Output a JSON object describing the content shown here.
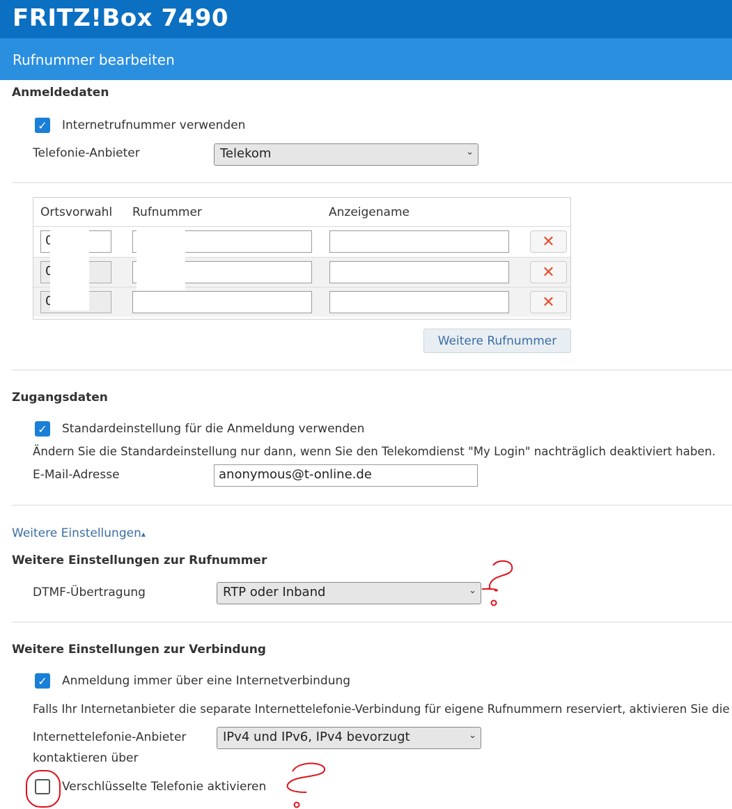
{
  "app": {
    "title": "FRITZ!Box 7490",
    "subtitle": "Rufnummer bearbeiten"
  },
  "anmeldedaten": {
    "heading": "Anmeldedaten",
    "use_internet_number_label": "Internetrufnummer verwenden",
    "use_internet_number_checked": true,
    "provider_label": "Telefonie-Anbieter",
    "provider_value": "Telekom"
  },
  "numbers_table": {
    "headers": [
      "Ortsvorwahl",
      "Rufnummer",
      "Anzeigename"
    ],
    "rows": [
      {
        "area_code": "0",
        "number": "",
        "display_name": ""
      },
      {
        "area_code": "0",
        "number": "",
        "display_name": ""
      },
      {
        "area_code": "0",
        "number": "",
        "display_name": ""
      }
    ],
    "delete_symbol": "✕",
    "add_button_label": "Weitere Rufnummer"
  },
  "zugangsdaten": {
    "heading": "Zugangsdaten",
    "default_label": "Standardeinstellung für die Anmeldung verwenden",
    "default_checked": true,
    "note": "Ändern Sie die Standardeinstellung nur dann, wenn Sie den Telekomdienst \"My Login\" nachträglich deaktiviert haben.",
    "email_label": "E-Mail-Adresse",
    "email_value": "anonymous@t-online.de"
  },
  "weitere": {
    "toggle_label": "Weitere Einstellungen",
    "toggle_arrow": "▴",
    "number_heading": "Weitere Einstellungen zur Rufnummer",
    "dtmf_label": "DTMF-Übertragung",
    "dtmf_value": "RTP oder Inband",
    "connection_heading": "Weitere Einstellungen zur Verbindung",
    "always_internet_label": "Anmeldung immer über eine Internetverbindung",
    "always_internet_checked": true,
    "separate_note": "Falls Ihr Internetanbieter die separate Internettelefonie-Verbindung für eigene Rufnummern reserviert, aktivieren Sie die",
    "contact_label_line1": "Internettelefonie-Anbieter",
    "contact_label_line2": "kontaktieren über",
    "contact_value": "IPv4 und IPv6, IPv4 bevorzugt",
    "encrypted_label": "Verschlüsselte Telefonie aktivieren",
    "encrypted_checked": false
  },
  "icons": {
    "checkmark": "✓",
    "select_arrow": "⌄"
  },
  "colors": {
    "header": "#0b6fc2",
    "subheader": "#2b8fe0",
    "accent": "#1a7fd6",
    "delete": "#e84c2b",
    "annotation": "#e0101a"
  }
}
